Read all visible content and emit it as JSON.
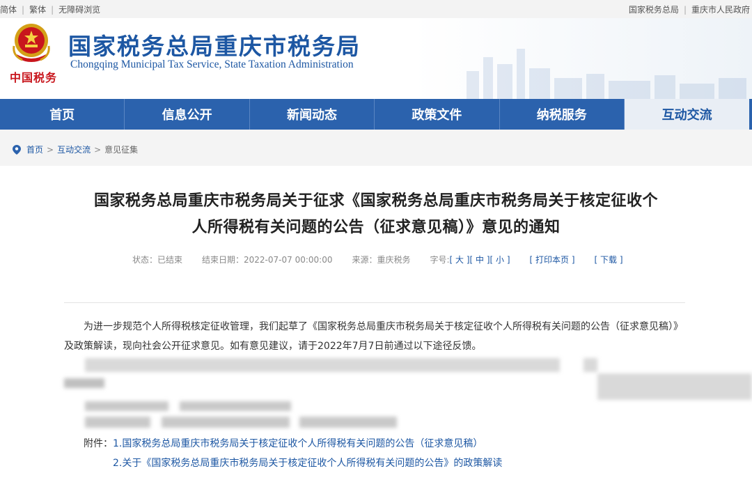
{
  "topbar": {
    "simplified": "简体",
    "traditional": "繁体",
    "accessible": "无障碍浏览",
    "link_state": "国家税务总局",
    "link_gov": "重庆市人民政府"
  },
  "header": {
    "brand_cn": "中国税务",
    "title": "国家税务总局重庆市税务局",
    "subtitle": "Chongqing Municipal Tax Service, State Taxation Administration"
  },
  "nav": {
    "items": [
      "首页",
      "信息公开",
      "新闻动态",
      "政策文件",
      "纳税服务",
      "互动交流"
    ],
    "active_index": 5
  },
  "breadcrumb": {
    "home": "首页",
    "section": "互动交流",
    "current": "意见征集",
    "separator": ">"
  },
  "article": {
    "title_line1": "国家税务总局重庆市税务局关于征求《国家税务总局重庆市税务局关于核定征收个",
    "title_line2": "人所得税有关问题的公告（征求意见稿）》意见的通知",
    "meta": {
      "status": "状态：已结束",
      "end_date": "结束日期：2022-07-07 00:00:00",
      "source": "来源：重庆税务",
      "font_size_label": "字号:",
      "size_large": "[ 大 ]",
      "size_medium": "[ 中 ]",
      "size_small": "[ 小 ]",
      "print": "[ 打印本页 ]",
      "download": "[ 下载 ]"
    },
    "paragraph": "为进一步规范个人所得税核定征收管理，我们起草了《国家税务总局重庆市税务局关于核定征收个人所得税有关问题的公告（征求意见稿）》及政策解读，现向社会公开征求意见。如有意见建议，请于2022年7月7日前通过以下途径反馈。",
    "attachments_label": "附件：",
    "attachment1": "1.国家税务总局重庆市税务局关于核定征收个人所得税有关问题的公告（征求意见稿）",
    "attachment2": "2.关于《国家税务总局重庆市税务局关于核定征收个人所得税有关问题的公告》的政策解读"
  },
  "colors": {
    "primary": "#2b62ad",
    "title_blue": "#1d57a3",
    "brand_red": "#c8161d"
  }
}
